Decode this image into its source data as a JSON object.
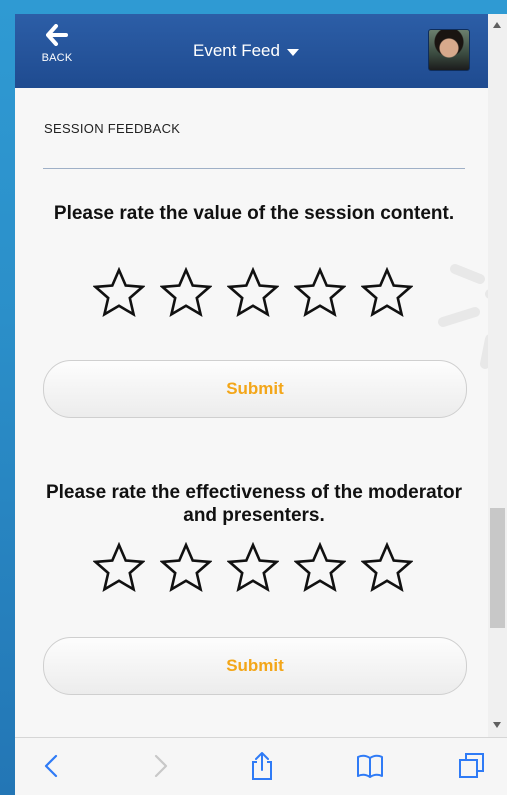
{
  "header": {
    "back_label": "BACK",
    "title": "Event Feed",
    "back_icon": "arrow-left-icon",
    "dropdown_icon": "caret-down-icon",
    "avatar": "user-avatar"
  },
  "section": {
    "title": "SESSION FEEDBACK"
  },
  "questions": [
    {
      "prompt": "Please rate the value of the session content.",
      "rating": 0,
      "max_rating": 5,
      "submit_label": "Submit"
    },
    {
      "prompt": "Please rate the effectiveness of the moderator and presenters.",
      "rating": 0,
      "max_rating": 5,
      "submit_label": "Submit"
    }
  ],
  "toolbar": {
    "items": [
      "back-icon",
      "forward-icon",
      "share-icon",
      "bookmarks-icon",
      "tabs-icon"
    ]
  },
  "colors": {
    "header_bg": "#244f95",
    "accent": "#f3a619",
    "toolbar_icons": "#2f7bf6",
    "background": "#2f9ad3"
  }
}
